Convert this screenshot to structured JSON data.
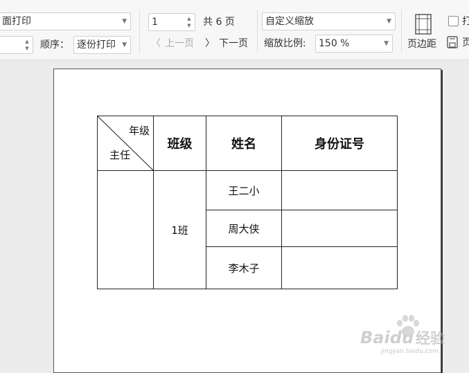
{
  "toolbar": {
    "print_mode_value": "面打印",
    "order_label": "顺序：",
    "order_value": "逐份打印",
    "page_number": "1",
    "page_total": "共 6 页",
    "prev_page": "上一页",
    "next_page": "下一页",
    "zoom_mode_value": "自定义缩放",
    "zoom_ratio_label": "缩放比例:",
    "zoom_ratio_value": "150 %",
    "margins_label": "页边距",
    "checkbox_label_partial": "打",
    "save_label_partial": "页"
  },
  "document": {
    "diag_top": "年级",
    "diag_bottom": "主任",
    "headers": [
      "班级",
      "姓名",
      "身份证号"
    ],
    "class_value": "1班",
    "names": [
      "王二小",
      "周大侠",
      "李木子"
    ]
  },
  "watermark": {
    "brand": "Baidu",
    "suffix": "经验",
    "url": "jingyan.baidu.com"
  }
}
